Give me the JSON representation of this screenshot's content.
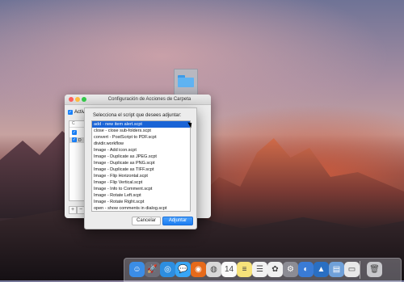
{
  "window": {
    "title": "Configuración de Acciones de Carpeta"
  },
  "enable": {
    "label": "Activar"
  },
  "folder_list": {
    "header": "C",
    "rows": [
      {
        "letter": ""
      },
      {
        "letter": "D"
      }
    ]
  },
  "sheet": {
    "prompt": "Selecciona el script que desees adjuntar:",
    "scripts": [
      "add - new item alert.scpt",
      "close - close sub-folders.scpt",
      "convert - PostScript to PDF.scpt",
      "dividir.workflow",
      "Image - Add icon.scpt",
      "Image - Duplicate as JPEG.scpt",
      "Image - Duplicate as PNG.scpt",
      "Image - Duplicate as TIFF.scpt",
      "Image - Flip Horizontal.scpt",
      "Image - Flip Vertical.scpt",
      "Image - Info to Comment.scpt",
      "Image - Rotate Left.scpt",
      "Image - Rotate Right.scpt",
      "open - show comments in dialog.scpt"
    ],
    "selected_index": 0,
    "cancel_label": "Cancelar",
    "attach_label": "Adjuntar"
  },
  "buttons": {
    "add": "+",
    "remove": "−"
  },
  "dock": {
    "icons": [
      {
        "name": "finder-icon",
        "glyph": "☺",
        "color": "#3b8de6"
      },
      {
        "name": "launchpad-icon",
        "glyph": "🚀",
        "color": "#6d6d78"
      },
      {
        "name": "safari-icon",
        "glyph": "◎",
        "color": "#2d8ee0"
      },
      {
        "name": "messages-icon",
        "glyph": "💬",
        "color": "#38a6f5"
      },
      {
        "name": "firefox-icon",
        "glyph": "◉",
        "color": "#e66a1a"
      },
      {
        "name": "chrome-icon",
        "glyph": "◍",
        "color": "#d8d8d8"
      },
      {
        "name": "calendar-icon",
        "glyph": "14",
        "color": "#fafafa"
      },
      {
        "name": "notes-icon",
        "glyph": "≡",
        "color": "#f6e27a"
      },
      {
        "name": "reminders-icon",
        "glyph": "☰",
        "color": "#f2f2f2"
      },
      {
        "name": "photos-icon",
        "glyph": "✿",
        "color": "#f0f0f0"
      },
      {
        "name": "system-preferences-icon",
        "glyph": "⚙",
        "color": "#8c8c94"
      },
      {
        "name": "network-utility-icon",
        "glyph": "◐",
        "color": "#3a7bd5"
      },
      {
        "name": "big-sur-icon",
        "glyph": "▲",
        "color": "#2a6fc2"
      },
      {
        "name": "preview-icon",
        "glyph": "▤",
        "color": "#6fa0d8"
      },
      {
        "name": "downloads-stack-icon",
        "glyph": "▭",
        "color": "#e8e8e8"
      },
      {
        "name": "trash-icon",
        "glyph": "🗑",
        "color": "#c8c8cc"
      }
    ]
  }
}
